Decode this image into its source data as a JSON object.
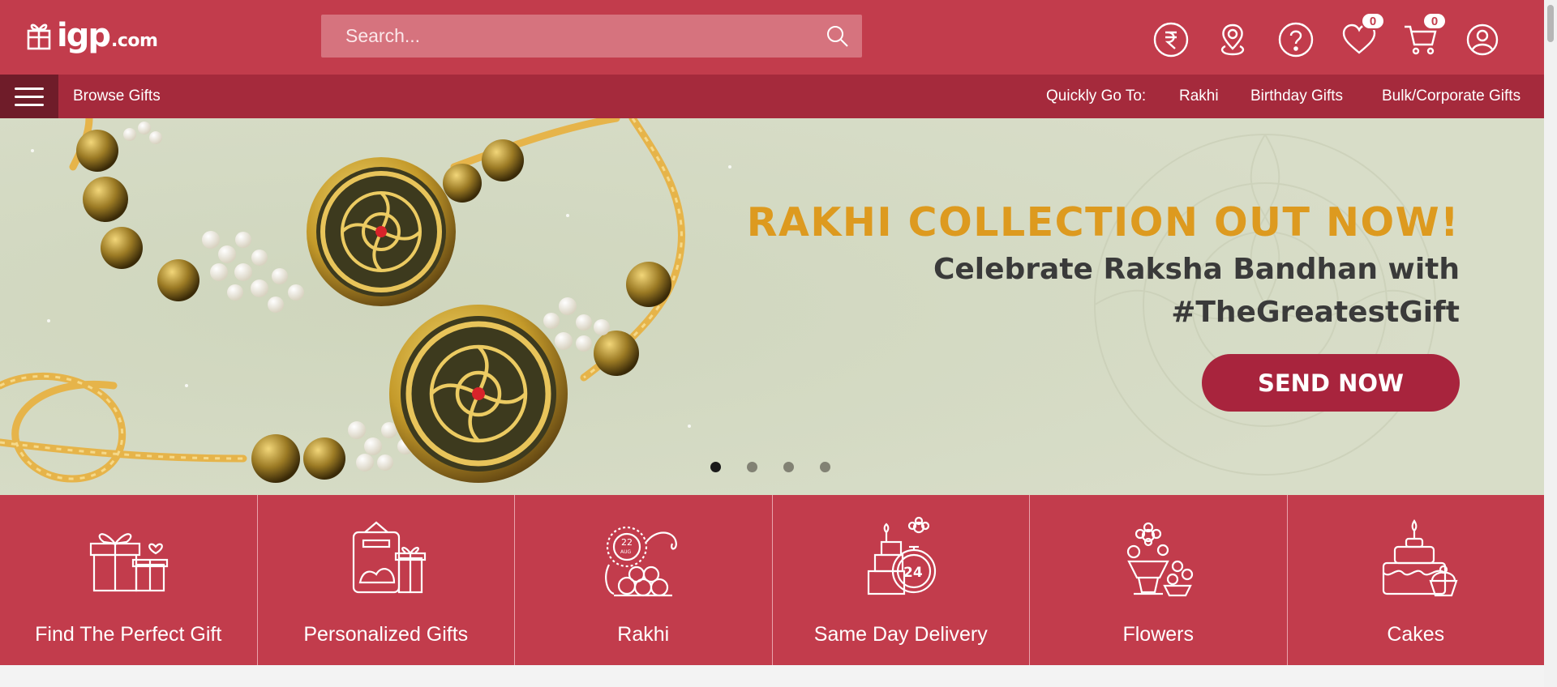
{
  "header": {
    "logo": {
      "mark": "igp",
      "domain": ".com",
      "icon": "gift-logo-icon"
    },
    "search": {
      "placeholder": "Search...",
      "icon": "search-icon"
    },
    "icons": {
      "currency": {
        "icon": "rupee-icon"
      },
      "location": {
        "icon": "location-pin-icon"
      },
      "help": {
        "icon": "help-icon"
      },
      "wishlist": {
        "icon": "heart-icon",
        "count": "0"
      },
      "cart": {
        "icon": "cart-icon",
        "count": "0"
      },
      "account": {
        "icon": "user-icon"
      }
    }
  },
  "nav": {
    "menu_icon": "hamburger-menu-icon",
    "browse_label": "Browse Gifts",
    "quick_label": "Quickly Go To:",
    "quick_links": [
      "Rakhi",
      "Birthday Gifts",
      "Bulk/Corporate Gifts"
    ]
  },
  "hero": {
    "title": "RAKHI COLLECTION OUT NOW!",
    "subtitle_line1": "Celebrate Raksha Bandhan with",
    "subtitle_line2": "#TheGreatestGift",
    "cta": "SEND NOW",
    "slides": 4,
    "active_slide": 1
  },
  "categories": [
    {
      "label": "Find The Perfect Gift",
      "icon": "gift-box-icon"
    },
    {
      "label": "Personalized Gifts",
      "icon": "personalized-gift-icon"
    },
    {
      "label": "Rakhi",
      "icon": "rakhi-icon"
    },
    {
      "label": "Same Day Delivery",
      "icon": "same-day-delivery-icon"
    },
    {
      "label": "Flowers",
      "icon": "flowers-icon"
    },
    {
      "label": "Cakes",
      "icon": "cake-icon"
    }
  ],
  "colors": {
    "brand": "#c23c4c",
    "nav": "#a52a3c",
    "menu_button": "#6f1c29",
    "hero_title": "#dd9a1f",
    "cta": "#a8243d",
    "hero_bg": "#d7dcc6"
  }
}
